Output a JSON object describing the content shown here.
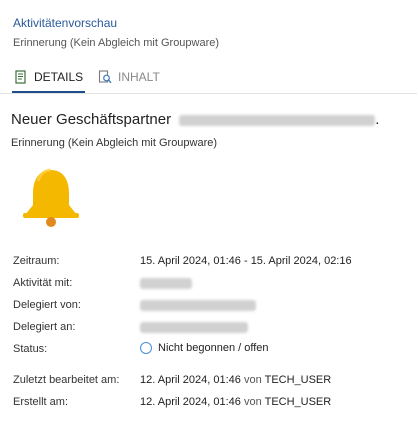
{
  "header": {
    "title": "Aktivitätenvorschau",
    "subtitle": "Erinnerung (Kein Abgleich mit Groupware)"
  },
  "tabs": [
    {
      "label": "DETAILS",
      "icon": "document-icon",
      "active": true
    },
    {
      "label": "INHALT",
      "icon": "search-document-icon",
      "active": false
    }
  ],
  "activity": {
    "title": "Neuer Geschäftspartner",
    "title_suffix": ".",
    "type": "Erinnerung (Kein Abgleich mit Groupware)",
    "icon": "bell-icon"
  },
  "details": {
    "zeitraum_label": "Zeitraum:",
    "zeitraum_value": "15. April 2024, 01:46 - 15. April 2024, 02:16",
    "aktivitaet_label": "Aktivität mit:",
    "delegiert_von_label": "Delegiert von:",
    "delegiert_an_label": "Delegiert an:",
    "status_label": "Status:",
    "status_value": "Nicht begonnen / offen",
    "bearbeitet_label": "Zuletzt bearbeitet am:",
    "bearbeitet_date": "12. April 2024, 01:46",
    "bearbeitet_von": "von",
    "bearbeitet_user": "TECH_USER",
    "erstellt_label": "Erstellt am:",
    "erstellt_date": "12. April 2024, 01:46",
    "erstellt_von": "von",
    "erstellt_user": "TECH_USER"
  },
  "colors": {
    "link": "#2a5a9c",
    "active_tab_underline": "#1f4e8c",
    "bell": "#f5b800",
    "status_circle": "#4a8fd8"
  }
}
